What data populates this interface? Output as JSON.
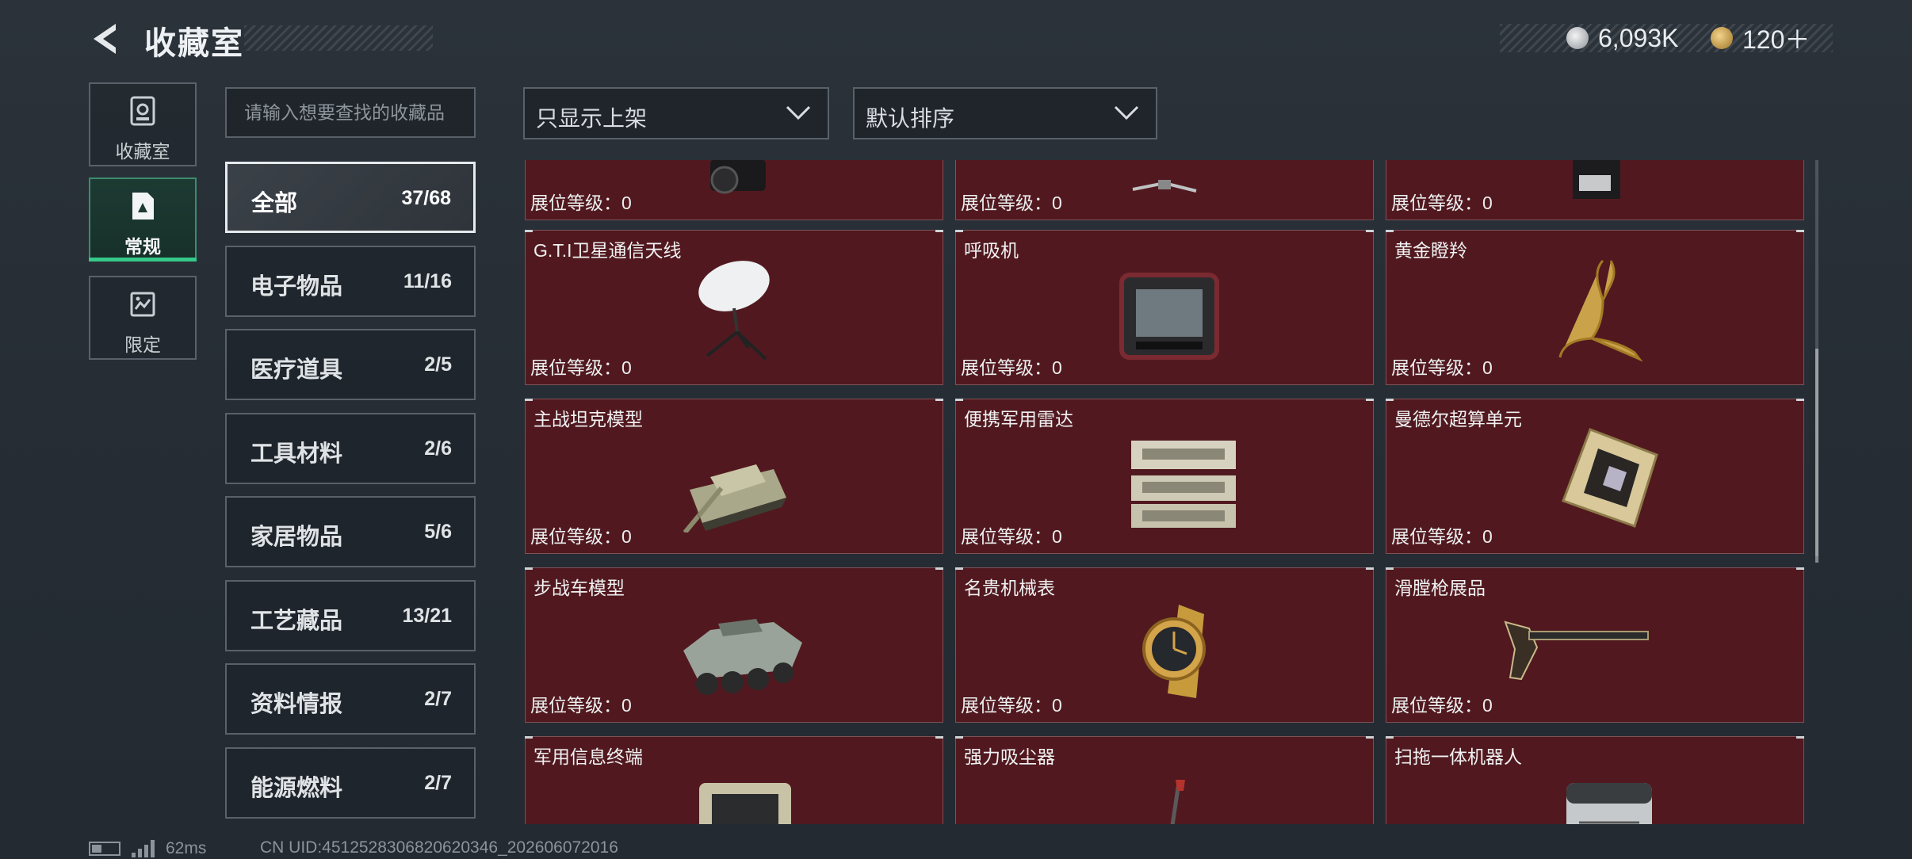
{
  "header": {
    "title": "收藏室",
    "currency": [
      {
        "icon": "silver-coin-icon",
        "amount": "6,093K",
        "color": "#c9ccd0"
      },
      {
        "icon": "gold-coin-icon",
        "amount": "120＋",
        "color": "#d4a64a"
      }
    ]
  },
  "nav": [
    {
      "label": "收藏室",
      "icon": "collection-room-icon",
      "active": false
    },
    {
      "label": "常规",
      "icon": "regular-icon",
      "active": true
    },
    {
      "label": "限定",
      "icon": "limited-icon",
      "active": false
    }
  ],
  "search": {
    "placeholder": "请输入想要查找的收藏品"
  },
  "filters": {
    "show": "只显示上架",
    "sort": "默认排序"
  },
  "categories": [
    {
      "name": "全部",
      "count": "37/68",
      "active": true
    },
    {
      "name": "电子物品",
      "count": "11/16"
    },
    {
      "name": "医疗道具",
      "count": "2/5"
    },
    {
      "name": "工具材料",
      "count": "2/6"
    },
    {
      "name": "家居物品",
      "count": "5/6"
    },
    {
      "name": "工艺藏品",
      "count": "13/21"
    },
    {
      "name": "资料情报",
      "count": "2/7"
    },
    {
      "name": "能源燃料",
      "count": "2/7"
    }
  ],
  "level_label": "展位等级：0",
  "items": [
    {
      "name": "",
      "icon": "camera-icon"
    },
    {
      "name": "",
      "icon": "drone-icon"
    },
    {
      "name": "",
      "icon": "coffee-machine-icon"
    },
    {
      "name": "G.T.I卫星通信天线",
      "icon": "satellite-dish-icon"
    },
    {
      "name": "呼吸机",
      "icon": "ventilator-icon"
    },
    {
      "name": "黄金瞪羚",
      "icon": "golden-gazelle-icon"
    },
    {
      "name": "主战坦克模型",
      "icon": "tank-model-icon"
    },
    {
      "name": "便携军用雷达",
      "icon": "portable-radar-icon"
    },
    {
      "name": "曼德尔超算单元",
      "icon": "supercomputer-unit-icon"
    },
    {
      "name": "步战车模型",
      "icon": "ifv-model-icon"
    },
    {
      "name": "名贵机械表",
      "icon": "luxury-watch-icon"
    },
    {
      "name": "滑膛枪展品",
      "icon": "musket-icon"
    },
    {
      "name": "军用信息终端",
      "icon": "military-terminal-icon"
    },
    {
      "name": "强力吸尘器",
      "icon": "vacuum-cleaner-icon"
    },
    {
      "name": "扫拖一体机器人",
      "icon": "mop-robot-icon"
    }
  ],
  "status": {
    "ping": "62ms",
    "uid": "CN UID:4512528306820620346_202606072016"
  }
}
